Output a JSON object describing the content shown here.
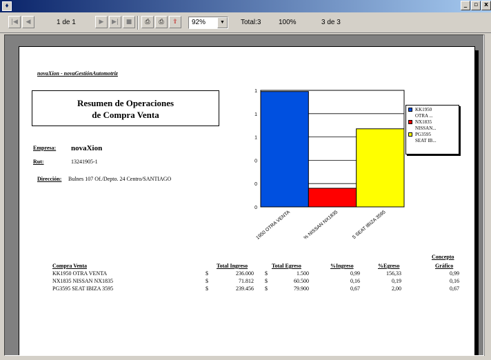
{
  "toolbar": {
    "page_indicator": "1 de 1",
    "zoom": "92%",
    "total": "Total:3",
    "percent": "100%",
    "record": "3 de 3"
  },
  "report": {
    "company_header": "novaXion - novaGestiónAutomotriz",
    "title_line1": "Resumen de Operaciones",
    "title_line2": "de Compra Venta",
    "empresa_label": "Empresa:",
    "empresa_value": "novaXion",
    "rut_label": "Rut:",
    "rut_value": "13241905-1",
    "direccion_label": "Dirección:",
    "direccion_value": "Bulnes 107 Of./Depto. 24 Centro/SANTIAGO"
  },
  "chart_data": {
    "type": "bar",
    "categories": [
      "KK1950 OTRA VENTA",
      "NX1835 NISSAN NX1835",
      "PG3595 SEAT IBIZA 3595"
    ],
    "category_labels": [
      "1950 OTRA VENTA",
      "% NISSAN NX1835",
      "5 SEAT IBIZA 3595"
    ],
    "values": [
      0.99,
      0.16,
      0.67
    ],
    "ytick_labels": [
      "1",
      "1",
      "1",
      "0",
      "0",
      "0"
    ],
    "ylim": [
      0,
      1
    ],
    "colors": [
      "#0050e0",
      "#ff0000",
      "#ffff00"
    ],
    "legend": [
      "KK1950",
      "OTRA ...",
      "NX1835",
      "NISSAN...",
      "PG3595",
      "SEAT IB..."
    ],
    "legend_colors": [
      "#0050e0",
      "",
      "#ff0000",
      "",
      "#ffff00",
      ""
    ],
    "legend_position": "right"
  },
  "table": {
    "headers": {
      "compra_venta": "Compra Venta",
      "total_ingreso": "Total Ingreso",
      "total_egreso": "Total Egreso",
      "pct_ingreso": "%Ingreso",
      "pct_egreso": "%Egreso",
      "concepto_1": "Concepto",
      "concepto_2": "Gráfico"
    },
    "rows": [
      {
        "name": "KK1950 OTRA VENTA",
        "cur1": "$",
        "ingreso": "236.000",
        "cur2": "$",
        "egreso": "1.500",
        "pct_ing": "0,99",
        "pct_egr": "156,33",
        "grafico": "0,99"
      },
      {
        "name": "NX1835 NISSAN NX1835",
        "cur1": "$",
        "ingreso": "71.812",
        "cur2": "$",
        "egreso": "60.500",
        "pct_ing": "0,16",
        "pct_egr": "0,19",
        "grafico": "0,16"
      },
      {
        "name": "PG3595 SEAT IBIZA 3595",
        "cur1": "$",
        "ingreso": "239.456",
        "cur2": "$",
        "egreso": "79.900",
        "pct_ing": "0,67",
        "pct_egr": "2,00",
        "grafico": "0,67"
      }
    ]
  }
}
